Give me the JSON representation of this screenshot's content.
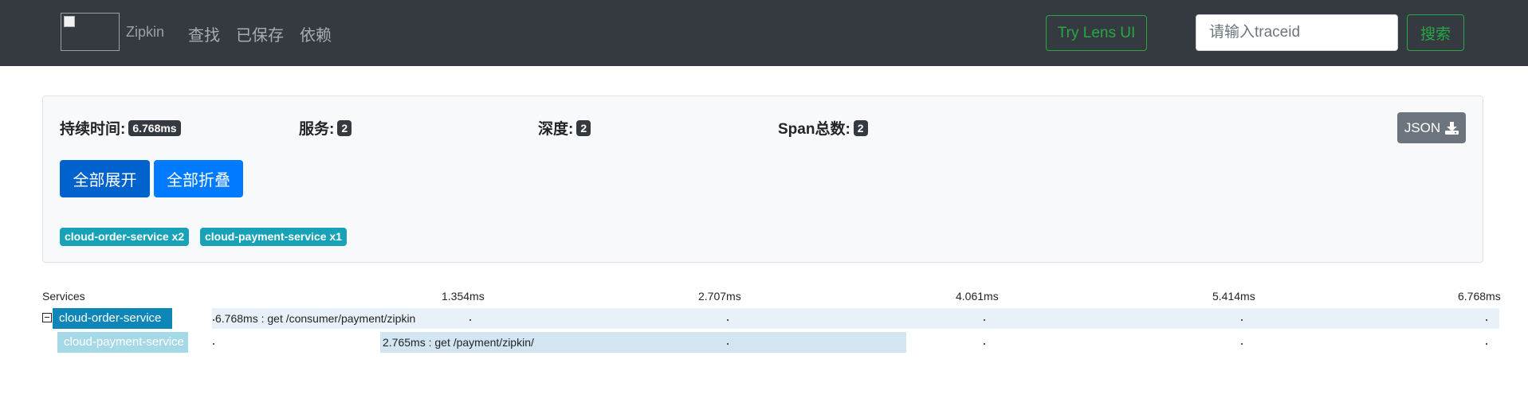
{
  "navbar": {
    "brand": "Zipkin",
    "links": [
      "查找",
      "已保存",
      "依赖"
    ],
    "lens_button": "Try Lens UI",
    "search_placeholder": "请输入traceid",
    "search_button": "搜索"
  },
  "summary": {
    "duration_label": "持续时间:",
    "duration_value": "6.768ms",
    "services_label": "服务:",
    "services_value": "2",
    "depth_label": "深度:",
    "depth_value": "2",
    "spans_label": "Span总数:",
    "spans_value": "2",
    "json_button": "JSON",
    "json_icon": "download-icon",
    "expand_all": "全部展开",
    "collapse_all": "全部折叠",
    "service_badges": [
      "cloud-order-service x2",
      "cloud-payment-service x1"
    ]
  },
  "timeline": {
    "services_header": "Services",
    "ticks": [
      "1.354ms",
      "2.707ms",
      "4.061ms",
      "5.414ms",
      "6.768ms"
    ],
    "rows": [
      {
        "service": "cloud-order-service",
        "label": "6.768ms : get /consumer/payment/zipkin"
      },
      {
        "service": "cloud-payment-service",
        "label": "2.765ms : get /payment/zipkin/"
      }
    ]
  },
  "colors": {
    "navbar_bg": "#343a40",
    "success": "#28a745",
    "primary": "#007bff",
    "info": "#17a2b8",
    "order_service": "#0e87b8",
    "payment_service": "#a6d9e8"
  }
}
